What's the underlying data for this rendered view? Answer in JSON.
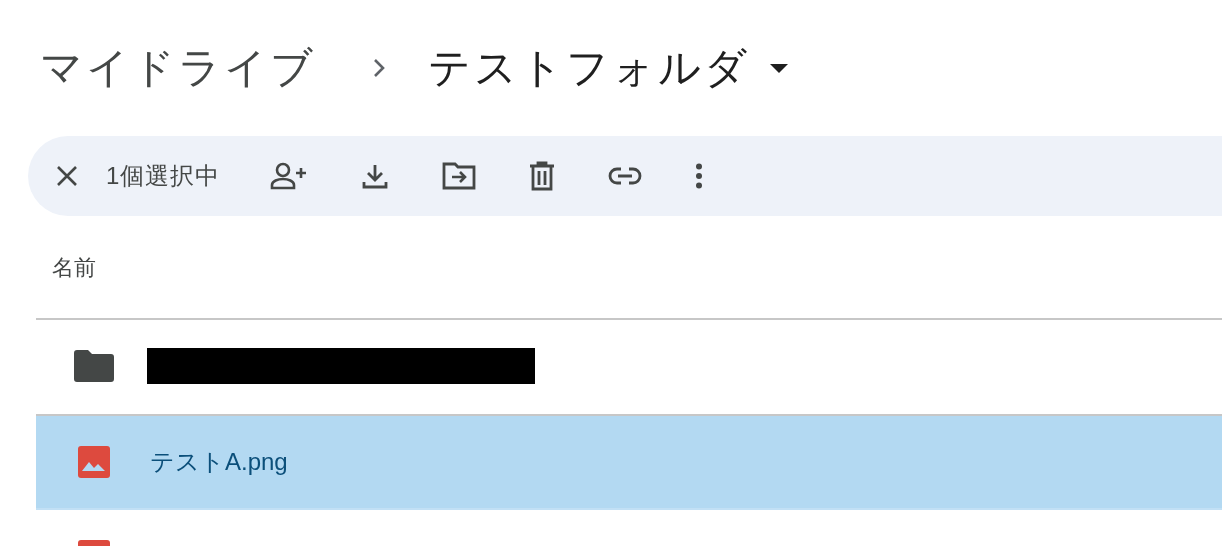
{
  "breadcrumb": [
    {
      "label": "マイドライブ",
      "current": false
    },
    {
      "label": "テストフォルダ",
      "current": true
    }
  ],
  "selection_bar": {
    "count_label": "1個選択中",
    "actions": [
      {
        "kind": "share"
      },
      {
        "kind": "download"
      },
      {
        "kind": "move"
      },
      {
        "kind": "delete"
      },
      {
        "kind": "link"
      },
      {
        "kind": "more"
      }
    ]
  },
  "table": {
    "columns": [
      "名前"
    ],
    "rows": [
      {
        "kind": "folder",
        "name_redacted": true,
        "selected": false
      },
      {
        "kind": "image",
        "name": "テストA.png",
        "selected": true
      },
      {
        "kind": "image",
        "selected": false
      }
    ]
  }
}
